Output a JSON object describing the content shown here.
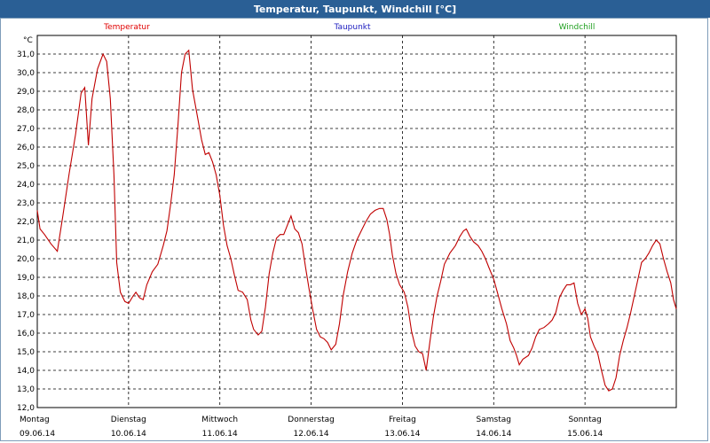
{
  "header": {
    "title": "Temperatur, Taupunkt, Windchill [°C]"
  },
  "chart_data": {
    "type": "line",
    "title": "Temperatur, Taupunkt, Windchill [°C]",
    "ylabel": "°C",
    "ylim": [
      12.0,
      32.0
    ],
    "yticks": [
      "12,0",
      "13,0",
      "14,0",
      "15,0",
      "16,0",
      "17,0",
      "18,0",
      "19,0",
      "20,0",
      "21,0",
      "22,0",
      "23,0",
      "24,0",
      "25,0",
      "26,0",
      "27,0",
      "28,0",
      "29,0",
      "30,0",
      "31,0"
    ],
    "grid": true,
    "legend_placement": "top",
    "legend": [
      {
        "name": "Temperatur",
        "color": "#e00000"
      },
      {
        "name": "Taupunkt",
        "color": "#2020c0"
      },
      {
        "name": "Windchill",
        "color": "#20a020"
      }
    ],
    "day_labels": [
      {
        "weekday": "Montag",
        "date": "09.06.14"
      },
      {
        "weekday": "Dienstag",
        "date": "10.06.14"
      },
      {
        "weekday": "Mittwoch",
        "date": "11.06.14"
      },
      {
        "weekday": "Donnerstag",
        "date": "12.06.14"
      },
      {
        "weekday": "Freitag",
        "date": "13.06.14"
      },
      {
        "weekday": "Samstag",
        "date": "14.06.14"
      },
      {
        "weekday": "Sonntag",
        "date": "15.06.14"
      }
    ],
    "xlim_days": [
      0,
      7.0
    ],
    "series": [
      {
        "name": "Temperatur",
        "color": "#c00000",
        "points": [
          [
            0.0,
            22.6
          ],
          [
            0.03,
            21.6
          ],
          [
            0.08,
            21.3
          ],
          [
            0.15,
            20.8
          ],
          [
            0.22,
            20.4
          ],
          [
            0.28,
            22.3
          ],
          [
            0.35,
            24.6
          ],
          [
            0.42,
            26.7
          ],
          [
            0.48,
            28.9
          ],
          [
            0.52,
            29.2
          ],
          [
            0.56,
            26.1
          ],
          [
            0.6,
            28.6
          ],
          [
            0.66,
            30.2
          ],
          [
            0.72,
            31.0
          ],
          [
            0.76,
            30.6
          ],
          [
            0.8,
            28.6
          ],
          [
            0.84,
            24.5
          ],
          [
            0.87,
            19.8
          ],
          [
            0.91,
            18.2
          ],
          [
            0.96,
            17.7
          ],
          [
            1.0,
            17.6
          ],
          [
            1.05,
            18.0
          ],
          [
            1.08,
            18.2
          ],
          [
            1.12,
            17.9
          ],
          [
            1.16,
            17.8
          ],
          [
            1.2,
            18.6
          ],
          [
            1.26,
            19.3
          ],
          [
            1.32,
            19.7
          ],
          [
            1.38,
            20.7
          ],
          [
            1.42,
            21.5
          ],
          [
            1.46,
            22.9
          ],
          [
            1.5,
            24.5
          ],
          [
            1.54,
            27.1
          ],
          [
            1.58,
            30.0
          ],
          [
            1.62,
            31.0
          ],
          [
            1.66,
            31.2
          ],
          [
            1.7,
            29.1
          ],
          [
            1.76,
            27.5
          ],
          [
            1.8,
            26.4
          ],
          [
            1.84,
            25.6
          ],
          [
            1.88,
            25.7
          ],
          [
            1.92,
            25.2
          ],
          [
            1.96,
            24.5
          ],
          [
            2.0,
            23.4
          ],
          [
            2.04,
            21.8
          ],
          [
            2.08,
            20.7
          ],
          [
            2.12,
            20.0
          ],
          [
            2.16,
            19.1
          ],
          [
            2.2,
            18.3
          ],
          [
            2.25,
            18.2
          ],
          [
            2.3,
            17.8
          ],
          [
            2.34,
            16.7
          ],
          [
            2.37,
            16.2
          ],
          [
            2.42,
            15.9
          ],
          [
            2.46,
            16.1
          ],
          [
            2.5,
            17.4
          ],
          [
            2.54,
            19.2
          ],
          [
            2.58,
            20.3
          ],
          [
            2.62,
            21.1
          ],
          [
            2.66,
            21.3
          ],
          [
            2.7,
            21.3
          ],
          [
            2.74,
            21.8
          ],
          [
            2.78,
            22.3
          ],
          [
            2.82,
            21.6
          ],
          [
            2.86,
            21.4
          ],
          [
            2.9,
            20.8
          ],
          [
            2.94,
            19.5
          ],
          [
            2.98,
            18.3
          ],
          [
            3.02,
            17.2
          ],
          [
            3.06,
            16.2
          ],
          [
            3.1,
            15.8
          ],
          [
            3.14,
            15.7
          ],
          [
            3.18,
            15.5
          ],
          [
            3.22,
            15.1
          ],
          [
            3.27,
            15.4
          ],
          [
            3.31,
            16.5
          ],
          [
            3.35,
            18.0
          ],
          [
            3.4,
            19.3
          ],
          [
            3.45,
            20.3
          ],
          [
            3.5,
            21.0
          ],
          [
            3.55,
            21.5
          ],
          [
            3.6,
            22.0
          ],
          [
            3.65,
            22.4
          ],
          [
            3.7,
            22.6
          ],
          [
            3.75,
            22.7
          ],
          [
            3.79,
            22.7
          ],
          [
            3.83,
            22.1
          ],
          [
            3.86,
            21.3
          ],
          [
            3.89,
            20.2
          ],
          [
            3.93,
            19.2
          ],
          [
            3.97,
            18.6
          ],
          [
            4.02,
            18.2
          ],
          [
            4.06,
            17.4
          ],
          [
            4.1,
            16.1
          ],
          [
            4.14,
            15.3
          ],
          [
            4.18,
            15.0
          ],
          [
            4.22,
            14.9
          ],
          [
            4.26,
            14.0
          ],
          [
            4.3,
            15.5
          ],
          [
            4.34,
            16.9
          ],
          [
            4.38,
            18.0
          ],
          [
            4.42,
            18.8
          ],
          [
            4.46,
            19.7
          ],
          [
            4.52,
            20.3
          ],
          [
            4.58,
            20.7
          ],
          [
            4.63,
            21.2
          ],
          [
            4.67,
            21.5
          ],
          [
            4.7,
            21.6
          ],
          [
            4.74,
            21.2
          ],
          [
            4.78,
            20.9
          ],
          [
            4.83,
            20.7
          ],
          [
            4.87,
            20.4
          ],
          [
            4.91,
            20.0
          ],
          [
            4.95,
            19.5
          ],
          [
            5.0,
            18.9
          ],
          [
            5.04,
            18.2
          ],
          [
            5.09,
            17.3
          ],
          [
            5.14,
            16.5
          ],
          [
            5.18,
            15.6
          ],
          [
            5.22,
            15.2
          ],
          [
            5.25,
            14.8
          ],
          [
            5.28,
            14.3
          ],
          [
            5.32,
            14.6
          ],
          [
            5.38,
            14.8
          ],
          [
            5.42,
            15.2
          ],
          [
            5.46,
            15.8
          ],
          [
            5.5,
            16.2
          ],
          [
            5.55,
            16.3
          ],
          [
            5.6,
            16.5
          ],
          [
            5.64,
            16.7
          ],
          [
            5.68,
            17.1
          ],
          [
            5.72,
            17.9
          ],
          [
            5.76,
            18.3
          ],
          [
            5.8,
            18.6
          ],
          [
            5.84,
            18.6
          ],
          [
            5.88,
            18.7
          ],
          [
            5.92,
            17.6
          ],
          [
            5.96,
            17.0
          ],
          [
            6.0,
            17.3
          ],
          [
            6.03,
            16.8
          ],
          [
            6.06,
            15.8
          ],
          [
            6.1,
            15.3
          ],
          [
            6.14,
            14.9
          ],
          [
            6.18,
            14.0
          ],
          [
            6.22,
            13.2
          ],
          [
            6.26,
            12.9
          ],
          [
            6.3,
            13.0
          ],
          [
            6.34,
            13.6
          ],
          [
            6.38,
            14.8
          ],
          [
            6.42,
            15.6
          ],
          [
            6.46,
            16.3
          ],
          [
            6.5,
            17.1
          ],
          [
            6.54,
            18.0
          ],
          [
            6.58,
            18.9
          ],
          [
            6.62,
            19.8
          ],
          [
            6.66,
            20.0
          ],
          [
            6.7,
            20.3
          ],
          [
            6.74,
            20.7
          ],
          [
            6.78,
            21.0
          ],
          [
            6.82,
            20.8
          ],
          [
            6.86,
            20.0
          ],
          [
            6.9,
            19.3
          ],
          [
            6.94,
            18.7
          ],
          [
            6.97,
            17.8
          ],
          [
            7.0,
            17.3
          ]
        ]
      }
    ]
  }
}
